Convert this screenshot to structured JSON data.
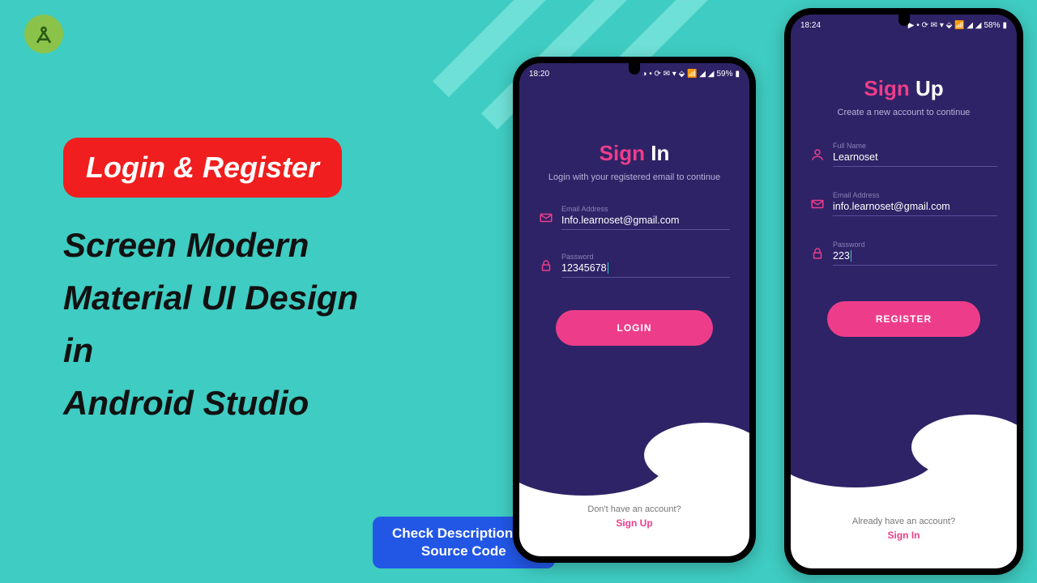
{
  "badge_text": "Login & Register",
  "subheading_lines": [
    "Screen Modern",
    "Material UI Design",
    "in",
    "Android Studio"
  ],
  "cta_line1": "Check Description for",
  "cta_line2": "Source Code",
  "phone1": {
    "status_time": "18:20",
    "status_batt": "59%",
    "title_a": "Sign",
    "title_b": "In",
    "subtitle": "Login with your registered email to continue",
    "email_label": "Email Address",
    "email_value": "Info.learnoset@gmail.com",
    "password_label": "Password",
    "password_value": "12345678",
    "button": "LOGIN",
    "footer_q": "Don't have an account?",
    "footer_link": "Sign Up"
  },
  "phone2": {
    "status_time": "18:24",
    "status_batt": "58%",
    "title_a": "Sign",
    "title_b": "Up",
    "subtitle": "Create a new account to continue",
    "name_label": "Full Name",
    "name_value": "Learnoset",
    "email_label": "Email Address",
    "email_value": "info.learnoset@gmail.com",
    "password_label": "Password",
    "password_value": "223",
    "button": "REGISTER",
    "footer_q": "Already have an account?",
    "footer_link": "Sign In"
  }
}
